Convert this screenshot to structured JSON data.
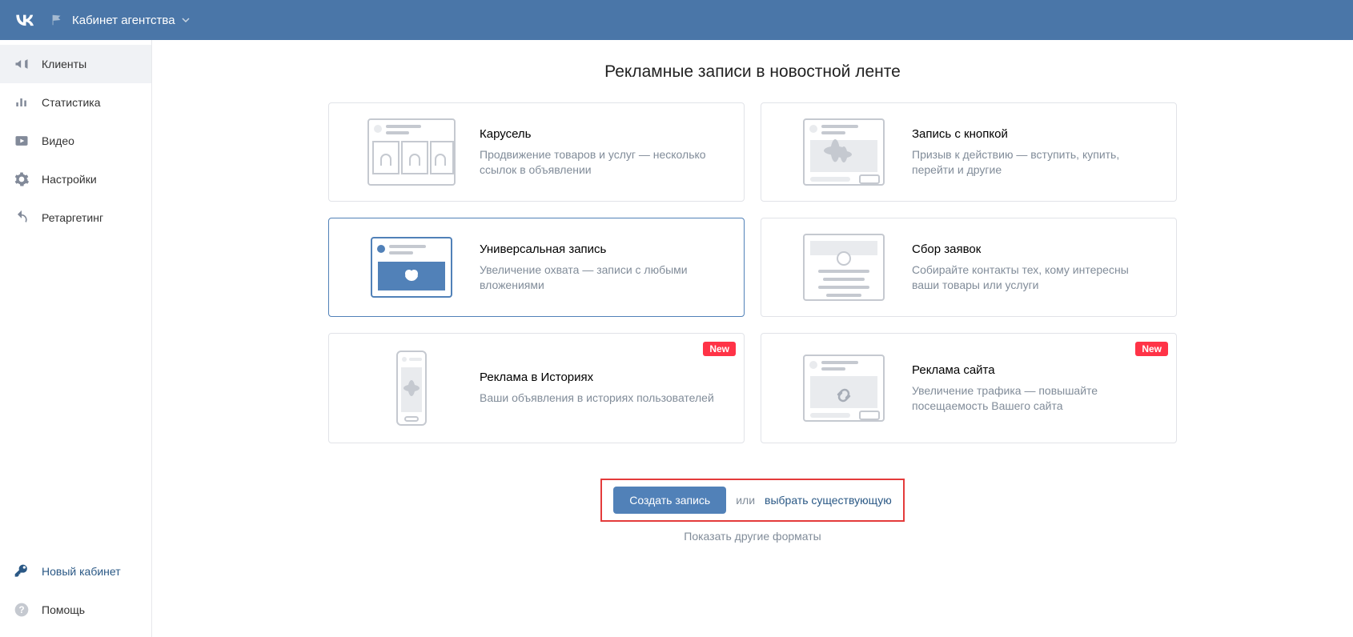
{
  "header": {
    "account_label": "Кабинет агентства"
  },
  "sidebar": {
    "items": [
      {
        "label": "Клиенты"
      },
      {
        "label": "Статистика"
      },
      {
        "label": "Видео"
      },
      {
        "label": "Настройки"
      },
      {
        "label": "Ретаргетинг"
      }
    ],
    "bottom": {
      "new_account": "Новый кабинет",
      "help": "Помощь"
    }
  },
  "main": {
    "title": "Рекламные записи в новостной ленте",
    "cards": [
      {
        "title": "Карусель",
        "desc": "Продвижение товаров и услуг — несколько ссылок в объявлении"
      },
      {
        "title": "Запись с кнопкой",
        "desc": "Призыв к действию — вступить, купить, перейти и другие"
      },
      {
        "title": "Универсальная запись",
        "desc": "Увеличение охвата — записи с любыми вложениями"
      },
      {
        "title": "Сбор заявок",
        "desc": "Собирайте контакты тех, кому интересны ваши товары или услуги"
      },
      {
        "title": "Реклама в Историях",
        "desc": "Ваши объявления в историях пользователей"
      },
      {
        "title": "Реклама сайта",
        "desc": "Увеличение трафика — повышайте посещаемость Вашего сайта"
      }
    ],
    "new_badge": "New",
    "actions": {
      "create": "Создать запись",
      "or": "или",
      "choose_existing": "выбрать существующую",
      "show_other": "Показать другие форматы"
    }
  }
}
